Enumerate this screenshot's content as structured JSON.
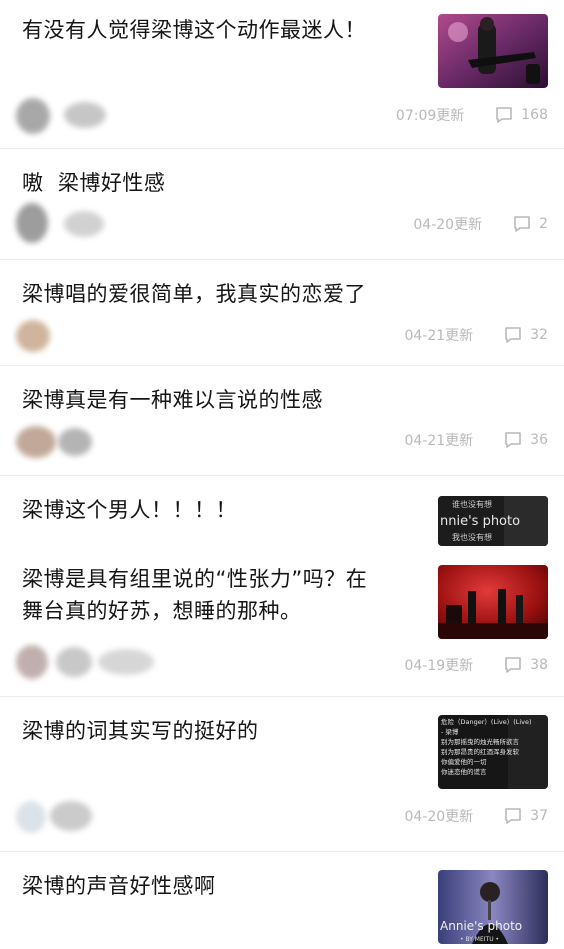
{
  "posts": [
    {
      "title": "有没有人觉得梁博这个动作最迷人！",
      "time": "07:09更新",
      "comments": "168",
      "thumb": "stage-guitar"
    },
    {
      "title": "嗷  梁博好性感",
      "time": "04-20更新",
      "comments": "2"
    },
    {
      "title": "梁博唱的爱很简单，我真实的恋爱了",
      "time": "04-21更新",
      "comments": "32"
    },
    {
      "title": "梁博真是有一种难以言说的性感",
      "time": "04-21更新",
      "comments": "36"
    },
    {
      "title": "梁博这个男人！！！！",
      "thumb": "annies-photo-1",
      "thumb_text": [
        "谁也没有想",
        "nnie's photo",
        "我也没有想"
      ]
    },
    {
      "title_lines": [
        "梁博是具有组里说的“性张力”吗？在",
        "舞台真的好苏，想睡的那种。"
      ],
      "time": "04-19更新",
      "comments": "38",
      "thumb": "stage-band"
    },
    {
      "title": "梁博的词其实写的挺好的",
      "time": "04-20更新",
      "comments": "37",
      "thumb": "lyrics",
      "thumb_text": [
        "危险（Danger）(Live）(Live)",
        "- 梁博",
        "别为那摇曳的烛光畅所欲言",
        "别为那昂贵的红酒浑身发软",
        "你偏爱他的一切",
        "你迷恋他的谎言"
      ]
    },
    {
      "title": "梁博的声音好性感啊",
      "thumb": "annies-photo-2",
      "thumb_text": [
        "Annie's photo",
        "• BY MEITU •"
      ]
    }
  ],
  "colors": {
    "meta": "#b9b9b9",
    "divider": "#ececec",
    "title": "#151515"
  },
  "icons": {
    "comment": "comment-bubble-icon"
  }
}
